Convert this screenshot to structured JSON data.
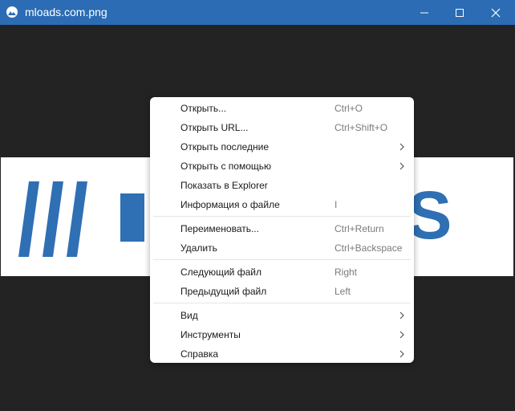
{
  "window": {
    "title": "mloads.com.png",
    "accent_color": "#2b6cb4",
    "controls": {
      "minimize_icon": "minimize-icon",
      "maximize_icon": "maximize-icon",
      "close_icon": "close-icon"
    }
  },
  "image": {
    "logo_text": "OS",
    "logo_color": "#2f6fb3",
    "background": "#ffffff"
  },
  "context_menu": {
    "groups": [
      [
        {
          "label": "Открыть...",
          "shortcut": "Ctrl+O",
          "submenu": false
        },
        {
          "label": "Открыть URL...",
          "shortcut": "Ctrl+Shift+O",
          "submenu": false
        },
        {
          "label": "Открыть последние",
          "shortcut": "",
          "submenu": true
        },
        {
          "label": "Открыть с помощью",
          "shortcut": "",
          "submenu": true
        },
        {
          "label": "Показать в Explorer",
          "shortcut": "",
          "submenu": false
        },
        {
          "label": "Информация о файле",
          "shortcut": "I",
          "submenu": false
        }
      ],
      [
        {
          "label": "Переименовать...",
          "shortcut": "Ctrl+Return",
          "submenu": false
        },
        {
          "label": "Удалить",
          "shortcut": "Ctrl+Backspace",
          "submenu": false
        }
      ],
      [
        {
          "label": "Следующий файл",
          "shortcut": "Right",
          "submenu": false
        },
        {
          "label": "Предыдущий файл",
          "shortcut": "Left",
          "submenu": false
        }
      ],
      [
        {
          "label": "Вид",
          "shortcut": "",
          "submenu": true
        },
        {
          "label": "Инструменты",
          "shortcut": "",
          "submenu": true
        },
        {
          "label": "Справка",
          "shortcut": "",
          "submenu": true
        }
      ]
    ]
  }
}
